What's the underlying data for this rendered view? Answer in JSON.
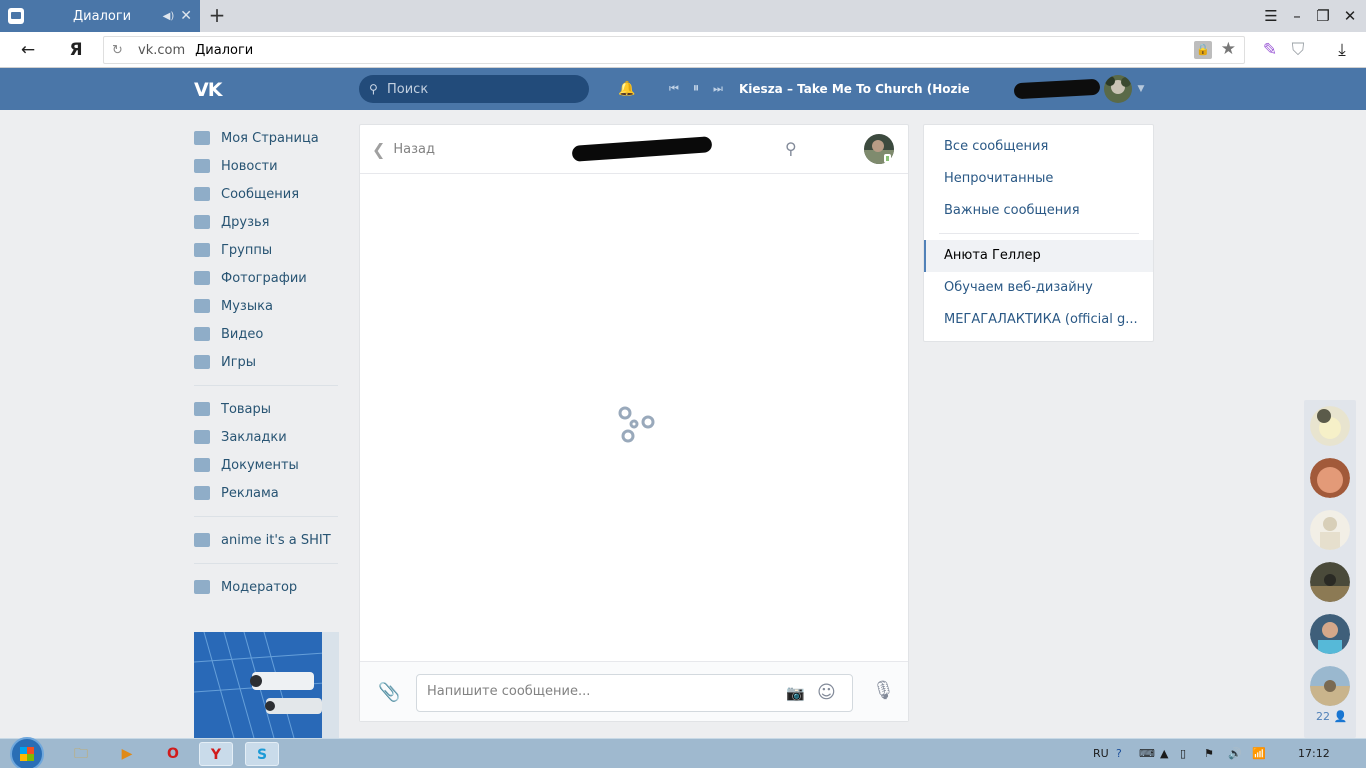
{
  "browser": {
    "tab_title": "Диалоги",
    "address_host": "vk.com",
    "address_title": "Диалоги",
    "yandex_letter": "Я"
  },
  "header": {
    "logo": "VK",
    "search_placeholder": "Поиск",
    "track": "Kiesza – Take Me To Church (Hozier..."
  },
  "leftnav": {
    "main": [
      {
        "label": "Моя Страница",
        "icon": "home-icon"
      },
      {
        "label": "Новости",
        "icon": "news-icon"
      },
      {
        "label": "Сообщения",
        "icon": "messages-icon"
      },
      {
        "label": "Друзья",
        "icon": "friends-icon"
      },
      {
        "label": "Группы",
        "icon": "groups-icon"
      },
      {
        "label": "Фотографии",
        "icon": "camera-icon"
      },
      {
        "label": "Музыка",
        "icon": "music-icon"
      },
      {
        "label": "Видео",
        "icon": "video-icon"
      },
      {
        "label": "Игры",
        "icon": "games-icon"
      }
    ],
    "secondary": [
      {
        "label": "Товары",
        "icon": "bag-icon"
      },
      {
        "label": "Закладки",
        "icon": "star-icon"
      },
      {
        "label": "Документы",
        "icon": "document-icon"
      },
      {
        "label": "Реклама",
        "icon": "megaphone-icon"
      }
    ],
    "group": {
      "label": "anime it's a SHIT",
      "icon": "group-icon"
    },
    "moderator": {
      "label": "Модератор",
      "icon": "grid-icon"
    }
  },
  "chat": {
    "back_label": "Назад",
    "input_placeholder": "Напишите сообщение..."
  },
  "rightpanel": {
    "all": "Все сообщения",
    "unread": "Непрочитанные",
    "important": "Важные сообщения",
    "conversations": [
      "Анюта Геллер",
      "Обучаем веб-дизайну",
      "МЕГАГАЛАКТИКА (official g..."
    ]
  },
  "friends": {
    "count": "22"
  },
  "taskbar": {
    "lang": "RU",
    "clock": "17:12"
  },
  "colors": {
    "vk_blue": "#4a76a8",
    "link": "#2a5885",
    "page_bg": "#edeef0"
  }
}
